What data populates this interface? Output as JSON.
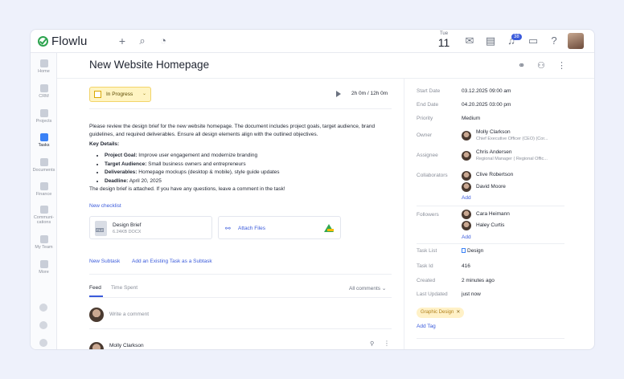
{
  "app": {
    "name": "Flowlu"
  },
  "topbar": {
    "date_dow": "Tue",
    "date_num": "11",
    "notif_count": "38"
  },
  "sidebar": {
    "items": [
      {
        "label": "Home",
        "icon": "home-icon"
      },
      {
        "label": "CRM",
        "icon": "crm-icon"
      },
      {
        "label": "Projects",
        "icon": "projects-icon"
      },
      {
        "label": "Tasks",
        "icon": "tasks-icon"
      },
      {
        "label": "Documents",
        "icon": "documents-icon"
      },
      {
        "label": "Finance",
        "icon": "finance-icon"
      },
      {
        "label": "Communi-\ncations",
        "icon": "communications-icon"
      },
      {
        "label": "My Team",
        "icon": "team-icon"
      },
      {
        "label": "More",
        "icon": "more-icon"
      }
    ]
  },
  "task": {
    "title": "New Website Homepage",
    "status": "In Progress",
    "timer": "2h 0m / 12h 0m",
    "description": "Please review the design brief for the new website homepage. The document includes project goals, target audience, brand guidelines, and required deliverables. Ensure all design elements align with the outlined objectives.",
    "key_details_title": "Key Details:",
    "key_details": [
      {
        "label": "Project Goal:",
        "text": " Improve user engagement and modernize branding"
      },
      {
        "label": "Target Audience:",
        "text": " Small business owners and entrepreneurs"
      },
      {
        "label": "Deliverables:",
        "text": " Homepage mockups (desktop & mobile), style guide updates"
      },
      {
        "label": "Deadline:",
        "text": " April 20, 2025"
      }
    ],
    "attached_note": "The design brief is attached. If you have any questions, leave a comment in the task!",
    "new_checklist": "New checklist",
    "file": {
      "name": "Design Brief",
      "meta": "6.24KB DOCX"
    },
    "attach_files": "Attach Files",
    "new_subtask": "New Subtask",
    "existing_subtask": "Add an Existing Task as a Subtask"
  },
  "feed": {
    "tab_feed": "Feed",
    "tab_time": "Time Spent",
    "all_comments": "All comments ⌄",
    "write_placeholder": "Write a comment",
    "comment_author": "Molly Clarkson"
  },
  "details": {
    "start_date_label": "Start Date",
    "start_date": "03.12.2025 09:00 am",
    "end_date_label": "End Date",
    "end_date": "04.20.2025 03:00 pm",
    "priority_label": "Priority",
    "priority": "Medium",
    "owner_label": "Owner",
    "owner_name": "Molly Clarkson",
    "owner_role": "Chief Executive Officer (CEO) (Cor...",
    "assignee_label": "Assignee",
    "assignee_name": "Chris Andersen",
    "assignee_role": "Regional Manager ( Regional Offic...",
    "collaborators_label": "Collaborators",
    "collab_1": "Clive Robertson",
    "collab_2": "David Moore",
    "add": "Add",
    "followers_label": "Followers",
    "follower_1": "Cara Heimann",
    "follower_2": "Haley Curtis",
    "task_list_label": "Task List",
    "task_list": "Design",
    "task_id_label": "Task Id",
    "task_id": "416",
    "created_label": "Created",
    "created": "2 minutes ago",
    "updated_label": "Last Updated",
    "updated": "just now",
    "tag": "Graphic Design",
    "add_tag": "Add Tag"
  }
}
